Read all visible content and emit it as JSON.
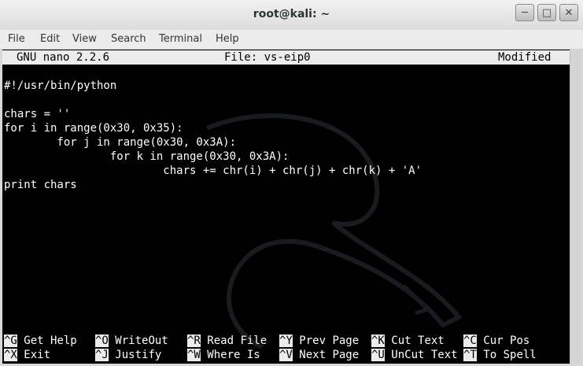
{
  "window": {
    "title": "root@kali: ~",
    "buttons": [
      "─",
      "□",
      "✕"
    ]
  },
  "menubar": {
    "items": [
      "File",
      "Edit",
      "View",
      "Search",
      "Terminal",
      "Help"
    ]
  },
  "nano": {
    "version": "GNU nano 2.2.6",
    "file": "File: vs-eip0",
    "status": "Modified"
  },
  "code": [
    "#!/usr/bin/python",
    "",
    "chars = ''",
    "for i in range(0x30, 0x35):",
    "        for j in range(0x30, 0x3A):",
    "                for k in range(0x30, 0x3A):",
    "                        chars += chr(i) + chr(j) + chr(k) + 'A'",
    "print chars"
  ],
  "shortcuts": {
    "row1": [
      {
        "key": "^G",
        "label": "Get Help"
      },
      {
        "key": "^O",
        "label": "WriteOut"
      },
      {
        "key": "^R",
        "label": "Read File"
      },
      {
        "key": "^Y",
        "label": "Prev Page"
      },
      {
        "key": "^K",
        "label": "Cut Text"
      },
      {
        "key": "^C",
        "label": "Cur Pos"
      }
    ],
    "row2": [
      {
        "key": "^X",
        "label": "Exit"
      },
      {
        "key": "^J",
        "label": "Justify"
      },
      {
        "key": "^W",
        "label": "Where Is"
      },
      {
        "key": "^V",
        "label": "Next Page"
      },
      {
        "key": "^U",
        "label": "UnCut Text"
      },
      {
        "key": "^T",
        "label": "To Spell"
      }
    ]
  },
  "colors": {
    "terminal_bg": "#000000",
    "terminal_fg": "#ffffff",
    "bar_bg": "#ececec"
  }
}
